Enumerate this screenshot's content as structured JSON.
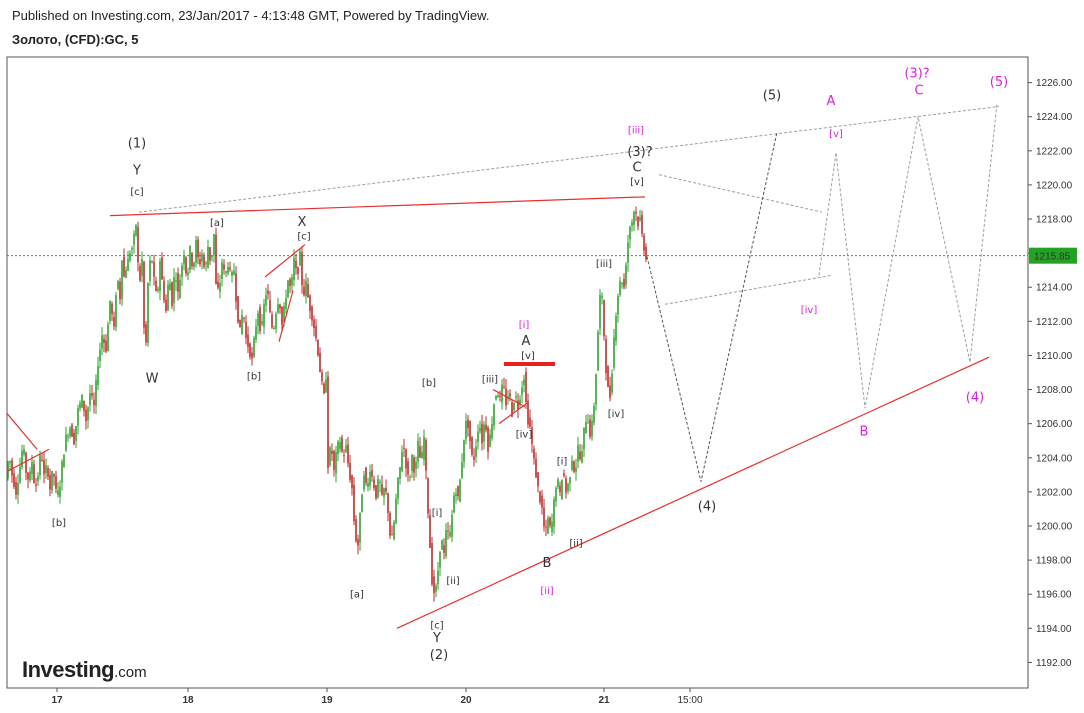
{
  "header": {
    "published": "Published on Investing.com, 23/Jan/2017 - 4:13:48 GMT, Powered by TradingView.",
    "symbol": "Золото, (CFD):GC, 5"
  },
  "logo": {
    "main": "Investing",
    "suffix": ".com"
  },
  "colors": {
    "up": "#2aa52a",
    "down": "#c62828",
    "red_line": "#e8302e",
    "grey_dash": "#9e9e9e",
    "dark_dash": "#555555",
    "magenta": "#e020e0",
    "current_line": "#23a323",
    "label_dark": "#333333"
  },
  "chart_data": {
    "type": "candlestick",
    "instrument": "Золото, (CFD):GC, 5",
    "y_axis": {
      "ticks": [
        "1192.00",
        "1194.00",
        "1196.00",
        "1198.00",
        "1200.00",
        "1202.00",
        "1204.00",
        "1206.00",
        "1208.00",
        "1210.00",
        "1212.00",
        "1214.00",
        "1216.00",
        "1218.00",
        "1220.00",
        "1222.00",
        "1224.00",
        "1226.00"
      ],
      "range": [
        1190.5,
        1227.5
      ]
    },
    "x_axis": {
      "ticks": [
        "17",
        "18",
        "19",
        "20",
        "21",
        "15:00"
      ]
    },
    "current_price": "1215.85",
    "price_path": [
      [
        0,
        1202.8
      ],
      [
        3,
        1204.2
      ],
      [
        6,
        1203.0
      ],
      [
        10,
        1202.0
      ],
      [
        14,
        1203.5
      ],
      [
        17,
        1204.8
      ],
      [
        20,
        1203.2
      ],
      [
        23,
        1202.6
      ],
      [
        26,
        1203.8
      ],
      [
        29,
        1202.1
      ],
      [
        32,
        1203.0
      ],
      [
        35,
        1204.5
      ],
      [
        38,
        1202.9
      ],
      [
        41,
        1203.6
      ],
      [
        44,
        1202.2
      ],
      [
        47,
        1203.4
      ],
      [
        50,
        1202.0
      ],
      [
        53,
        1201.9
      ],
      [
        56,
        1203.6
      ],
      [
        60,
        1205.2
      ],
      [
        64,
        1205.8
      ],
      [
        68,
        1205.0
      ],
      [
        72,
        1206.8
      ],
      [
        76,
        1207.5
      ],
      [
        80,
        1206.2
      ],
      [
        84,
        1207.8
      ],
      [
        88,
        1207.0
      ],
      [
        92,
        1209.6
      ],
      [
        96,
        1211.2
      ],
      [
        100,
        1210.4
      ],
      [
        104,
        1213.2
      ],
      [
        108,
        1211.5
      ],
      [
        111,
        1214.8
      ],
      [
        114,
        1213.4
      ],
      [
        116,
        1215.8
      ],
      [
        119,
        1214.0
      ],
      [
        121,
        1216.3
      ],
      [
        123,
        1214.8
      ],
      [
        125,
        1217.4
      ],
      [
        127,
        1215.2
      ],
      [
        129,
        1218.6
      ],
      [
        131,
        1216.8
      ],
      [
        133,
        1213.9
      ],
      [
        136,
        1215.6
      ],
      [
        138,
        1211.6
      ],
      [
        140,
        1210.7
      ],
      [
        142,
        1214.2
      ],
      [
        145,
        1216.1
      ],
      [
        148,
        1214.4
      ],
      [
        151,
        1213.2
      ],
      [
        154,
        1215.6
      ],
      [
        157,
        1213.8
      ],
      [
        160,
        1212.6
      ],
      [
        163,
        1214.8
      ],
      [
        166,
        1213.1
      ],
      [
        169,
        1215.2
      ],
      [
        172,
        1213.6
      ],
      [
        175,
        1215.0
      ],
      [
        178,
        1216.0
      ],
      [
        181,
        1214.4
      ],
      [
        184,
        1216.2
      ],
      [
        187,
        1215.0
      ],
      [
        190,
        1216.6
      ],
      [
        193,
        1215.2
      ],
      [
        196,
        1216.0
      ],
      [
        199,
        1214.8
      ],
      [
        202,
        1216.4
      ],
      [
        205,
        1215.3
      ],
      [
        208,
        1217.1
      ],
      [
        210,
        1214.1
      ],
      [
        213,
        1213.7
      ],
      [
        216,
        1215.5
      ],
      [
        219,
        1214.6
      ],
      [
        222,
        1215.4
      ],
      [
        225,
        1214.5
      ],
      [
        228,
        1215.0
      ],
      [
        231,
        1212.6
      ],
      [
        234,
        1211.4
      ],
      [
        237,
        1212.8
      ],
      [
        240,
        1211.0
      ],
      [
        243,
        1210.4
      ],
      [
        246,
        1209.7
      ],
      [
        249,
        1211.4
      ],
      [
        252,
        1212.6
      ],
      [
        255,
        1211.2
      ],
      [
        258,
        1212.9
      ],
      [
        261,
        1214.0
      ],
      [
        264,
        1212.4
      ],
      [
        267,
        1211.3
      ],
      [
        270,
        1212.6
      ],
      [
        273,
        1213.5
      ],
      [
        276,
        1211.8
      ],
      [
        279,
        1213.1
      ],
      [
        282,
        1214.4
      ],
      [
        285,
        1213.8
      ],
      [
        288,
        1215.6
      ],
      [
        291,
        1214.6
      ],
      [
        294,
        1215.9
      ],
      [
        297,
        1213.4
      ],
      [
        300,
        1214.2
      ],
      [
        303,
        1213.0
      ],
      [
        306,
        1212.3
      ],
      [
        309,
        1211.4
      ],
      [
        312,
        1210.2
      ],
      [
        315,
        1208.6
      ],
      [
        318,
        1207.6
      ],
      [
        320,
        1208.8
      ],
      [
        322,
        1203.6
      ],
      [
        325,
        1204.8
      ],
      [
        328,
        1203.2
      ],
      [
        331,
        1204.6
      ],
      [
        334,
        1205.0
      ],
      [
        337,
        1204.0
      ],
      [
        340,
        1204.6
      ],
      [
        343,
        1203.2
      ],
      [
        346,
        1202.2
      ],
      [
        349,
        1199.4
      ],
      [
        352,
        1198.9
      ],
      [
        355,
        1201.4
      ],
      [
        358,
        1203.2
      ],
      [
        361,
        1202.0
      ],
      [
        364,
        1203.4
      ],
      [
        367,
        1202.6
      ],
      [
        370,
        1201.8
      ],
      [
        373,
        1202.9
      ],
      [
        376,
        1201.6
      ],
      [
        379,
        1202.4
      ],
      [
        382,
        1200.9
      ],
      [
        385,
        1198.8
      ],
      [
        388,
        1200.2
      ],
      [
        391,
        1202.2
      ],
      [
        394,
        1203.4
      ],
      [
        397,
        1205.0
      ],
      [
        400,
        1203.6
      ],
      [
        403,
        1202.5
      ],
      [
        406,
        1204.1
      ],
      [
        409,
        1203.0
      ],
      [
        412,
        1204.8
      ],
      [
        415,
        1203.6
      ],
      [
        418,
        1205.2
      ],
      [
        420,
        1203.0
      ],
      [
        423,
        1199.8
      ],
      [
        426,
        1196.8
      ],
      [
        429,
        1195.8
      ],
      [
        432,
        1197.4
      ],
      [
        435,
        1199.4
      ],
      [
        438,
        1198.3
      ],
      [
        441,
        1200.2
      ],
      [
        443,
        1199.0
      ],
      [
        446,
        1200.6
      ],
      [
        449,
        1202.4
      ],
      [
        452,
        1201.6
      ],
      [
        455,
        1203.2
      ],
      [
        458,
        1205.2
      ],
      [
        461,
        1206.4
      ],
      [
        464,
        1205.0
      ],
      [
        467,
        1203.6
      ],
      [
        470,
        1204.8
      ],
      [
        473,
        1206.2
      ],
      [
        476,
        1205.0
      ],
      [
        479,
        1206.4
      ],
      [
        482,
        1204.6
      ],
      [
        485,
        1205.6
      ],
      [
        488,
        1207.2
      ],
      [
        491,
        1208.0
      ],
      [
        494,
        1207.4
      ],
      [
        497,
        1208.4
      ],
      [
        500,
        1207.2
      ],
      [
        503,
        1207.9
      ],
      [
        506,
        1206.6
      ],
      [
        509,
        1207.8
      ],
      [
        512,
        1207.0
      ],
      [
        515,
        1208.0
      ],
      [
        518,
        1208.8
      ],
      [
        521,
        1206.4
      ],
      [
        524,
        1205.8
      ],
      [
        527,
        1204.2
      ],
      [
        530,
        1203.0
      ],
      [
        533,
        1201.8
      ],
      [
        536,
        1201.0
      ],
      [
        539,
        1199.4
      ],
      [
        542,
        1200.4
      ],
      [
        545,
        1199.6
      ],
      [
        548,
        1201.4
      ],
      [
        551,
        1202.9
      ],
      [
        554,
        1201.8
      ],
      [
        557,
        1203.4
      ],
      [
        560,
        1202.0
      ],
      [
        563,
        1202.6
      ],
      [
        566,
        1204.0
      ],
      [
        569,
        1203.0
      ],
      [
        572,
        1204.6
      ],
      [
        575,
        1203.6
      ],
      [
        578,
        1205.6
      ],
      [
        581,
        1206.6
      ],
      [
        584,
        1205.4
      ],
      [
        587,
        1206.2
      ],
      [
        590,
        1209.0
      ],
      [
        593,
        1212.6
      ],
      [
        595,
        1214.3
      ],
      [
        598,
        1211.2
      ],
      [
        601,
        1208.2
      ],
      [
        604,
        1207.6
      ],
      [
        606,
        1209.2
      ],
      [
        609,
        1212.0
      ],
      [
        612,
        1213.6
      ],
      [
        615,
        1214.6
      ],
      [
        618,
        1214.0
      ],
      [
        621,
        1216.2
      ],
      [
        624,
        1217.6
      ],
      [
        627,
        1218.0
      ],
      [
        629,
        1219.0
      ],
      [
        631,
        1217.6
      ],
      [
        634,
        1218.0
      ],
      [
        637,
        1216.6
      ],
      [
        640,
        1215.8
      ]
    ],
    "wave_labels": [
      {
        "text": "(1)",
        "i": 130,
        "p": 1222.2,
        "c": "dark",
        "s": 13
      },
      {
        "text": "Y",
        "i": 130,
        "p": 1220.6,
        "c": "dark",
        "s": 13
      },
      {
        "text": "[c]",
        "i": 130,
        "p": 1219.4,
        "c": "dark",
        "s": 10
      },
      {
        "text": "W",
        "i": 145,
        "p": 1208.4,
        "c": "dark",
        "s": 13
      },
      {
        "text": "[a]",
        "i": 210,
        "p": 1217.6,
        "c": "dark",
        "s": 10
      },
      {
        "text": "[b]",
        "i": 247,
        "p": 1208.6,
        "c": "dark",
        "s": 10
      },
      {
        "text": "X",
        "i": 295,
        "p": 1217.6,
        "c": "dark",
        "s": 13
      },
      {
        "text": "[c]",
        "i": 297,
        "p": 1216.8,
        "c": "dark",
        "s": 10
      },
      {
        "text": "[b]",
        "i": 52,
        "p": 1200.0,
        "c": "dark",
        "s": 10
      },
      {
        "text": "[a]",
        "i": 350,
        "p": 1195.8,
        "c": "dark",
        "s": 10
      },
      {
        "text": "[b]",
        "i": 422,
        "p": 1208.2,
        "c": "dark",
        "s": 10
      },
      {
        "text": "[i]",
        "i": 430,
        "p": 1200.6,
        "c": "dark",
        "s": 10
      },
      {
        "text": "[ii]",
        "i": 446,
        "p": 1196.6,
        "c": "dark",
        "s": 10
      },
      {
        "text": "[c]",
        "i": 430,
        "p": 1194.0,
        "c": "dark",
        "s": 10
      },
      {
        "text": "Y",
        "i": 430,
        "p": 1193.2,
        "c": "dark",
        "s": 13
      },
      {
        "text": "(2)",
        "i": 432,
        "p": 1192.2,
        "c": "dark",
        "s": 13
      },
      {
        "text": "[iii]",
        "i": 483,
        "p": 1208.4,
        "c": "dark",
        "s": 10
      },
      {
        "text": "[iv]",
        "i": 517,
        "p": 1205.2,
        "c": "dark",
        "s": 10
      },
      {
        "text": "[i]",
        "i": 517,
        "p": 1211.6,
        "c": "magenta",
        "s": 10
      },
      {
        "text": "A",
        "i": 519,
        "p": 1210.6,
        "c": "dark",
        "s": 13
      },
      {
        "text": "[v]",
        "i": 521,
        "p": 1209.8,
        "c": "dark",
        "s": 10
      },
      {
        "text": "B",
        "i": 540,
        "p": 1197.6,
        "c": "dark",
        "s": 13
      },
      {
        "text": "[ii]",
        "i": 540,
        "p": 1196.0,
        "c": "magenta",
        "s": 10
      },
      {
        "text": "[i]",
        "i": 555,
        "p": 1203.6,
        "c": "dark",
        "s": 10
      },
      {
        "text": "[ii]",
        "i": 569,
        "p": 1198.8,
        "c": "dark",
        "s": 10
      },
      {
        "text": "[iii]",
        "i": 597,
        "p": 1215.2,
        "c": "dark",
        "s": 10
      },
      {
        "text": "[iv]",
        "i": 609,
        "p": 1206.4,
        "c": "dark",
        "s": 10
      },
      {
        "text": "[iii]",
        "i": 629,
        "p": 1223.0,
        "c": "magenta",
        "s": 10
      },
      {
        "text": "(3)?",
        "i": 633,
        "p": 1221.7,
        "c": "dark",
        "s": 13
      },
      {
        "text": "C",
        "i": 630,
        "p": 1220.8,
        "c": "dark",
        "s": 13
      },
      {
        "text": "[v]",
        "i": 630,
        "p": 1220.0,
        "c": "dark",
        "s": 10
      },
      {
        "text": "(4)",
        "i": 700,
        "p": 1200.9,
        "c": "dark",
        "s": 13
      },
      {
        "text": "(5)",
        "i": 765,
        "p": 1225.0,
        "c": "dark",
        "s": 13
      },
      {
        "text": "A",
        "i": 824,
        "p": 1224.7,
        "c": "magenta",
        "s": 13
      },
      {
        "text": "[v]",
        "i": 829,
        "p": 1222.8,
        "c": "magenta",
        "s": 10
      },
      {
        "text": "[iv]",
        "i": 802,
        "p": 1212.5,
        "c": "magenta",
        "s": 10
      },
      {
        "text": "B",
        "i": 857,
        "p": 1205.3,
        "c": "magenta",
        "s": 13
      },
      {
        "text": "(3)?",
        "i": 910,
        "p": 1226.3,
        "c": "magenta",
        "s": 13
      },
      {
        "text": "C",
        "i": 912,
        "p": 1225.3,
        "c": "magenta",
        "s": 13
      },
      {
        "text": "(4)",
        "i": 968,
        "p": 1207.3,
        "c": "magenta",
        "s": 13
      },
      {
        "text": "(5)",
        "i": 992,
        "p": 1225.8,
        "c": "magenta",
        "s": 13
      }
    ],
    "lines": {
      "red": [
        [
          [
            103,
            1218.2
          ],
          [
            638,
            1219.3
          ]
        ],
        [
          [
            390,
            1194.0
          ],
          [
            982,
            1209.9
          ]
        ],
        [
          [
            0,
            1206.6
          ],
          [
            30,
            1204.5
          ]
        ],
        [
          [
            0,
            1203.2
          ],
          [
            42,
            1204.5
          ]
        ],
        [
          [
            258,
            1214.6
          ],
          [
            298,
            1216.5
          ]
        ],
        [
          [
            272,
            1210.8
          ],
          [
            286,
            1213.8
          ]
        ],
        [
          [
            492,
            1206.0
          ],
          [
            520,
            1207.2
          ]
        ],
        [
          [
            486,
            1208.0
          ],
          [
            518,
            1207.0
          ]
        ]
      ],
      "red_bold": [
        [
          [
            497,
            1209.5
          ],
          [
            548,
            1209.5
          ]
        ]
      ],
      "grey_dashed": [
        [
          [
            132,
            1218.4
          ],
          [
            992,
            1224.6
          ]
        ],
        [
          [
            652,
            1220.6
          ],
          [
            815,
            1218.4
          ]
        ],
        [
          [
            658,
            1213.0
          ],
          [
            825,
            1214.7
          ]
        ],
        [
          [
            812,
            1214.7
          ],
          [
            829,
            1221.9
          ],
          [
            858,
            1206.9
          ],
          [
            911,
            1224.0
          ],
          [
            963,
            1209.6
          ],
          [
            990,
            1224.8
          ]
        ]
      ],
      "dark_dashed": [
        [
          [
            640,
            1215.8
          ],
          [
            694,
            1202.6
          ],
          [
            770,
            1223.1
          ]
        ]
      ]
    },
    "current_line_price": 1215.85
  }
}
